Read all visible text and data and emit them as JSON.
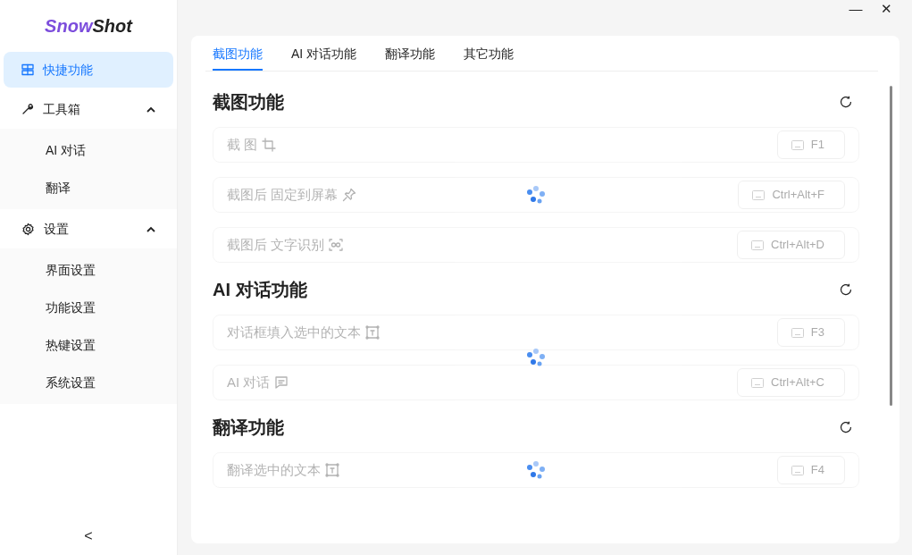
{
  "app": {
    "logo_first": "Snow",
    "logo_second": "Shot"
  },
  "sidebar": {
    "items": [
      {
        "label": "快捷功能",
        "kind": "grid",
        "selected": true
      },
      {
        "label": "工具箱",
        "kind": "wrench",
        "selected": false,
        "expanded": true,
        "children": [
          {
            "label": "AI 对话",
            "selected": false
          },
          {
            "label": "翻译",
            "selected": false
          }
        ]
      },
      {
        "label": "设置",
        "kind": "gear",
        "selected": false,
        "expanded": true,
        "children": [
          {
            "label": "界面设置",
            "selected": false
          },
          {
            "label": "功能设置",
            "selected": false
          },
          {
            "label": "热键设置",
            "selected": false
          },
          {
            "label": "系统设置",
            "selected": false
          }
        ]
      }
    ],
    "collapse": "<"
  },
  "window_controls": {
    "minimize": "—",
    "close": "✕"
  },
  "tabs": [
    {
      "label": "截图功能",
      "selected": true
    },
    {
      "label": "AI 对话功能",
      "selected": false
    },
    {
      "label": "翻译功能",
      "selected": false
    },
    {
      "label": "其它功能",
      "selected": false
    }
  ],
  "sections": [
    {
      "title": "截图功能",
      "loading": true,
      "rows": [
        {
          "label": "截 图",
          "kind": "crop",
          "hotkey": "F1"
        },
        {
          "label": "截图后 固定到屏幕",
          "kind": "pin",
          "hotkey": "Ctrl+Alt+F"
        },
        {
          "label": "截图后 文字识别",
          "kind": "scan",
          "hotkey": "Ctrl+Alt+D"
        }
      ]
    },
    {
      "title": "AI 对话功能",
      "loading": true,
      "rows": [
        {
          "label": "对话框填入选中的文本",
          "kind": "textselect",
          "hotkey": "F3"
        },
        {
          "label": "AI 对话",
          "kind": "chat",
          "hotkey": "Ctrl+Alt+C"
        }
      ]
    },
    {
      "title": "翻译功能",
      "loading": true,
      "rows": [
        {
          "label": "翻译选中的文本",
          "kind": "textselect",
          "hotkey": "F4"
        }
      ]
    }
  ]
}
